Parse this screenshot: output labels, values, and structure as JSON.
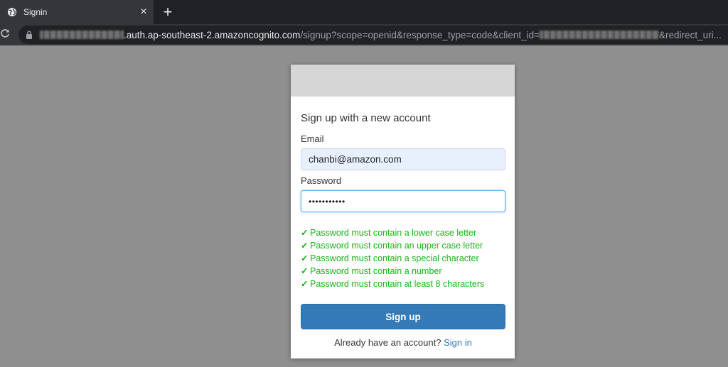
{
  "browser": {
    "tab_title": "Signin",
    "tab_close": "×",
    "new_tab": "+",
    "reload": "C",
    "url_host": ".auth.ap-southeast-2.amazoncognito.com",
    "url_path": "/signup?scope=openid&response_type=code&client_id=",
    "url_tail": "&redirect_uri..."
  },
  "form": {
    "title": "Sign up with a new account",
    "email_label": "Email",
    "email_value": "chanbi@amazon.com",
    "password_label": "Password",
    "password_value": "•••••••••••",
    "rules": [
      "Password must contain a lower case letter",
      "Password must contain an upper case letter",
      "Password must contain a special character",
      "Password must contain a number",
      "Password must contain at least 8 characters"
    ],
    "rule_check": "✓",
    "signup_label": "Sign up",
    "footer_text": "Already have an account?",
    "signin_link": "Sign in"
  },
  "colors": {
    "page_bg": "#8f8f8f",
    "primary": "#337ab7",
    "success": "#19b319",
    "banner": "#d6d6d6"
  }
}
